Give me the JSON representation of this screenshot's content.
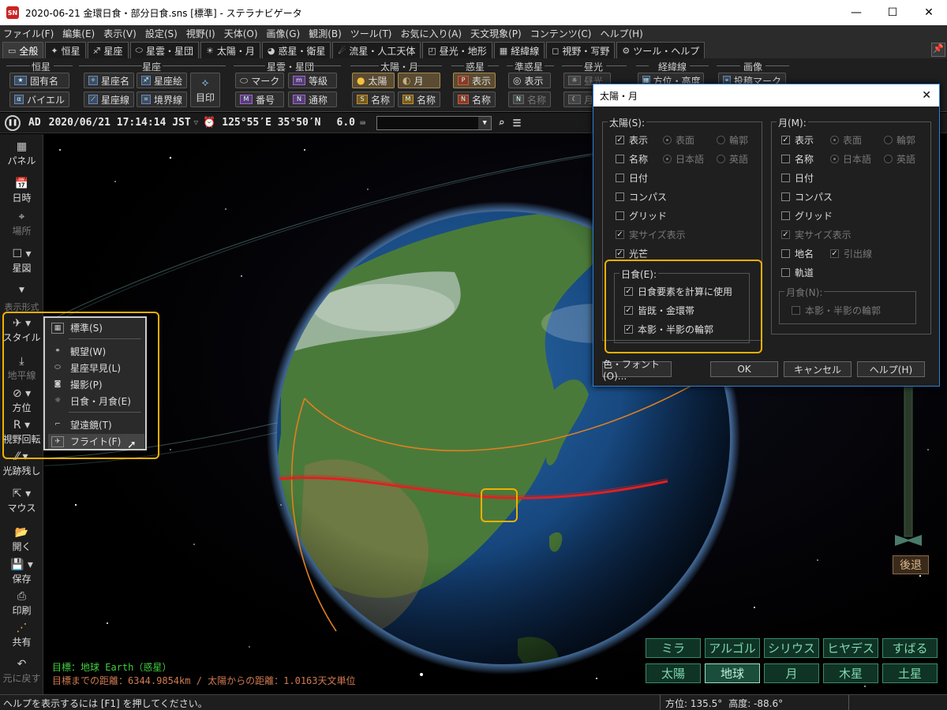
{
  "window": {
    "title": "2020-06-21 金環日食・部分日食.sns [標準] - ステラナビゲータ",
    "app_icon": "SN",
    "minimize": "—",
    "maximize": "☐",
    "close": "✕"
  },
  "menu": [
    "ファイル(F)",
    "編集(E)",
    "表示(V)",
    "設定(S)",
    "視野(I)",
    "天体(O)",
    "画像(G)",
    "観測(B)",
    "ツール(T)",
    "お気に入り(A)",
    "天文現象(P)",
    "コンテンツ(C)",
    "ヘルプ(H)"
  ],
  "tabs": [
    {
      "label": "全般",
      "icon": "▭"
    },
    {
      "label": "恒星",
      "icon": "✦"
    },
    {
      "label": "星座",
      "icon": "♐"
    },
    {
      "label": "星雲・星団",
      "icon": "⬭"
    },
    {
      "label": "太陽・月",
      "icon": "☀"
    },
    {
      "label": "惑星・衛星",
      "icon": "◕"
    },
    {
      "label": "流星・人工天体",
      "icon": "☄"
    },
    {
      "label": "昼光・地形",
      "icon": "◰"
    },
    {
      "label": "経緯線",
      "icon": "▦"
    },
    {
      "label": "視野・写野",
      "icon": "◻"
    },
    {
      "label": "ツール・ヘルプ",
      "icon": "⚙"
    }
  ],
  "ribbon": {
    "groups": [
      "恒星",
      "星座",
      "星雲・星団",
      "太陽・月",
      "惑星",
      "準惑星",
      "昼光",
      "経緯線",
      "画像"
    ],
    "buttons": {
      "koyumei": "固有名",
      "bayer": "バイエル",
      "seizamei": "星座名",
      "seizasen": "星座線",
      "seizae": "星座絵",
      "kyokaisen": "境界線",
      "mejirushi": "目印",
      "mark": "マーク",
      "bango": "番号",
      "toukyu": "等級",
      "tsusho": "通称",
      "taiyo": "太陽",
      "tsuki": "月",
      "taiyo_meisho": "名称",
      "tsuki_meisho": "名称",
      "wakusei_hyoji": "表示",
      "wakusei_meisho": "名称",
      "jun_hyoji": "表示",
      "jun_meisho": "名称",
      "chuko": "昼光",
      "tsukiakari": "月明",
      "hoi_kodo": "方位・高度",
      "toko_mark": "投稿マーク"
    }
  },
  "coords": {
    "era": "AD",
    "datetime": "2020/06/21 17:14:14 JST",
    "location": "125°55′E 35°50′N",
    "magnitude": "6.0"
  },
  "leftbar": {
    "panel": "パネル",
    "nichiji": "日時",
    "basho": "場所",
    "seizu": "星図",
    "hyoji_keishiki": "表示形式",
    "style": "スタイル",
    "chiheisen": "地平線",
    "hoi": "方位",
    "shiya_kaiten": "視野回転",
    "koseki": "光跡残し",
    "mouse": "マウス",
    "hiraku": "開く",
    "hozon": "保存",
    "insatsu": "印刷",
    "kyoyu": "共有",
    "modosu": "元に戻す"
  },
  "style_menu": [
    "標準(S)",
    "観望(W)",
    "星座早見(L)",
    "撮影(P)",
    "日食・月食(E)",
    "望遠鏡(T)",
    "フライト(F)"
  ],
  "view": {
    "target_label": "目標：地球 Earth（惑星）",
    "distance_label": "目標までの距離：6344.9854km / 太陽からの距離：1.0163天文単位",
    "back_button": "後退",
    "bookmarks_row1": [
      "ミラ",
      "アルゴル",
      "シリウス",
      "ヒヤデス",
      "すばる"
    ],
    "bookmarks_row2": [
      "太陽",
      "地球",
      "月",
      "木星",
      "土星"
    ],
    "selected_bookmark": "地球"
  },
  "dialog": {
    "title": "太陽・月",
    "sun_group": "太陽(S):",
    "moon_group": "月(M):",
    "sun": {
      "hyoji": "表示",
      "hyomen": "表面",
      "rinkaku": "輪郭",
      "meisho": "名称",
      "nihongo": "日本語",
      "eigo": "英語",
      "hizuke": "日付",
      "compass": "コンパス",
      "grid": "グリッド",
      "jitsu_size": "実サイズ表示",
      "kobo": "光芒"
    },
    "moon": {
      "hyoji": "表示",
      "hyomen": "表面",
      "rinkaku": "輪郭",
      "meisho": "名称",
      "nihongo": "日本語",
      "eigo": "英語",
      "hizuke": "日付",
      "compass": "コンパス",
      "grid": "グリッド",
      "jitsu_size": "実サイズ表示",
      "chimei": "地名",
      "hikidashisen": "引出線",
      "kido": "軌道"
    },
    "eclipse_group": "日食(E):",
    "eclipse": {
      "calc": "日食要素を計算に使用",
      "kaiki": "皆既・金環帯",
      "honkage": "本影・半影の輪郭"
    },
    "lunar_group": "月食(N):",
    "lunar": {
      "honkage": "本影・半影の輪郭"
    },
    "buttons": {
      "color_font": "色・フォント(O)...",
      "ok": "OK",
      "cancel": "キャンセル",
      "help": "ヘルプ(H)"
    }
  },
  "status": {
    "help": "ヘルプを表示するには [F1] を押してください。",
    "azimuth": "方位: 135.5°",
    "altitude": "高度: -88.6°"
  },
  "colors": {
    "highlight": "#f0b000",
    "eclipse_path": "#e02020",
    "orbit": "#e08020",
    "bookmark_text": "#7fd8b0"
  }
}
